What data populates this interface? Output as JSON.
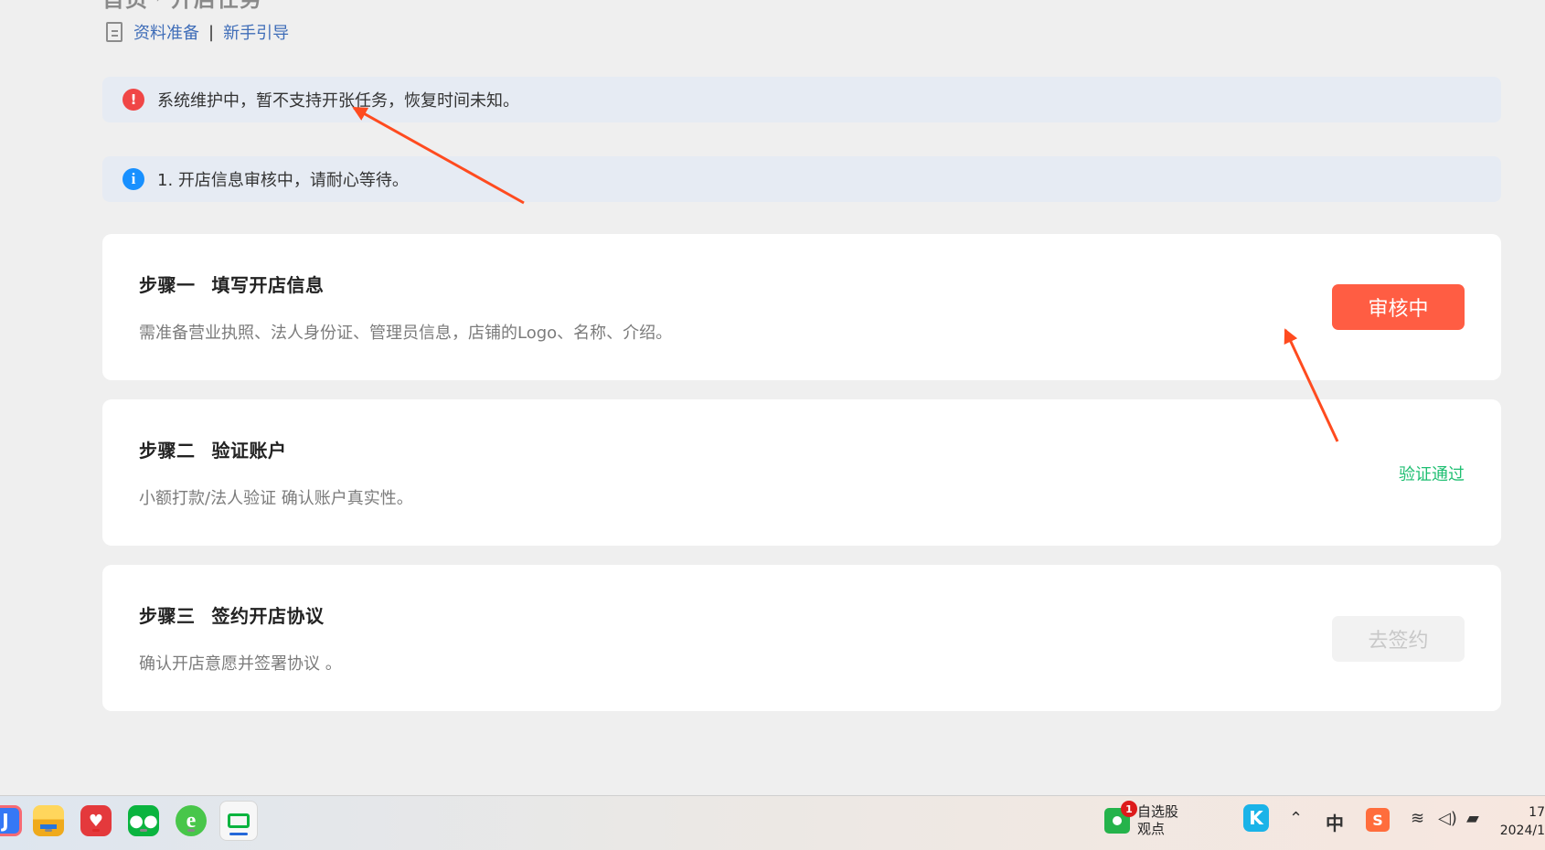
{
  "breadcrumb": {
    "items": [
      "首页",
      "开店任务"
    ]
  },
  "header_links": {
    "doc_icon": "doc-icon",
    "material_prep": "资料准备",
    "divider": "|",
    "beginner_guide": "新手引导"
  },
  "alerts": {
    "maintenance": {
      "icon": "error-icon",
      "badge": "!",
      "text": "系统维护中，暂不支持开张任务，恢复时间未知。"
    },
    "review_notice": {
      "icon": "info-icon",
      "badge": "i",
      "text": "1. 开店信息审核中，请耐心等待。"
    }
  },
  "steps": [
    {
      "step": "步骤一",
      "title": "填写开店信息",
      "description": "需准备营业执照、法人身份证、管理员信息，店铺的Logo、名称、介绍。",
      "action": "审核中"
    },
    {
      "step": "步骤二",
      "title": "验证账户",
      "description": "小额打款/法人验证 确认账户真实性。",
      "status": "验证通过"
    },
    {
      "step": "步骤三",
      "title": "签约开店协议",
      "description": "确认开店意愿并签署协议 。",
      "action": "去签约"
    }
  ],
  "annotation_colors": {
    "arrow": "#ff4b1f"
  },
  "taskbar": {
    "apps": [
      "partial-app-icon",
      "file-explorer-icon",
      "pinduoduo-icon",
      "wechat-icon",
      "browser-e-icon",
      "remote-desktop-icon"
    ],
    "stock_widget": {
      "badge": "1",
      "line1": "自选股",
      "line2": "观点"
    },
    "tray": {
      "ime": "中",
      "icons": [
        "k-app-icon",
        "chevron-up-icon",
        "sogou-icon",
        "wifi-icon",
        "volume-icon",
        "battery-icon"
      ]
    },
    "clock": {
      "time": "17",
      "date": "2024/1"
    }
  },
  "colors": {
    "primary_button": "#ff5d43",
    "success_text": "#1fbf72",
    "alert_background": "#e6ebf3",
    "error_badge": "#f04646",
    "info_badge": "#1890ff"
  }
}
